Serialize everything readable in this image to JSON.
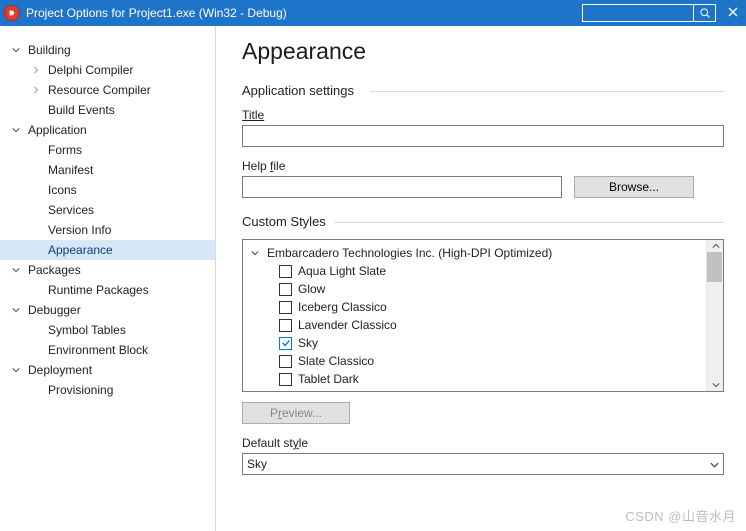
{
  "window": {
    "title": "Project Options for Project1.exe  (Win32 - Debug)"
  },
  "search": {
    "placeholder": ""
  },
  "tree": {
    "building": {
      "label": "Building",
      "delphi": "Delphi Compiler",
      "resource": "Resource Compiler",
      "events": "Build Events"
    },
    "application": {
      "label": "Application",
      "forms": "Forms",
      "manifest": "Manifest",
      "icons": "Icons",
      "services": "Services",
      "version": "Version Info",
      "appearance": "Appearance"
    },
    "packages": {
      "label": "Packages",
      "runtime": "Runtime Packages"
    },
    "debugger": {
      "label": "Debugger",
      "symbols": "Symbol Tables",
      "env": "Environment Block"
    },
    "deployment": {
      "label": "Deployment",
      "prov": "Provisioning"
    }
  },
  "content": {
    "heading": "Appearance",
    "appSettings": "Application settings",
    "titleLabel": "Title",
    "titleValue": "",
    "helpLabelPrefix": "Help ",
    "helpLabelU": "f",
    "helpLabelSuffix": "ile",
    "helpValue": "",
    "browse": "Browse...",
    "customStyles": "Custom Styles",
    "group": "Embarcadero Technologies Inc. (High-DPI Optimized)",
    "styles": {
      "s0": "Aqua Light Slate",
      "s1": "Glow",
      "s2": "Iceberg Classico",
      "s3": "Lavender Classico",
      "s4": "Sky",
      "s5": "Slate Classico",
      "s6": "Tablet Dark"
    },
    "previewPrefix": "P",
    "previewU": "r",
    "previewSuffix": "eview...",
    "defaultPrefix": "Default st",
    "defaultU": "y",
    "defaultSuffix": "le",
    "defaultValue": "Sky"
  },
  "watermark": "CSDN @山音水月"
}
